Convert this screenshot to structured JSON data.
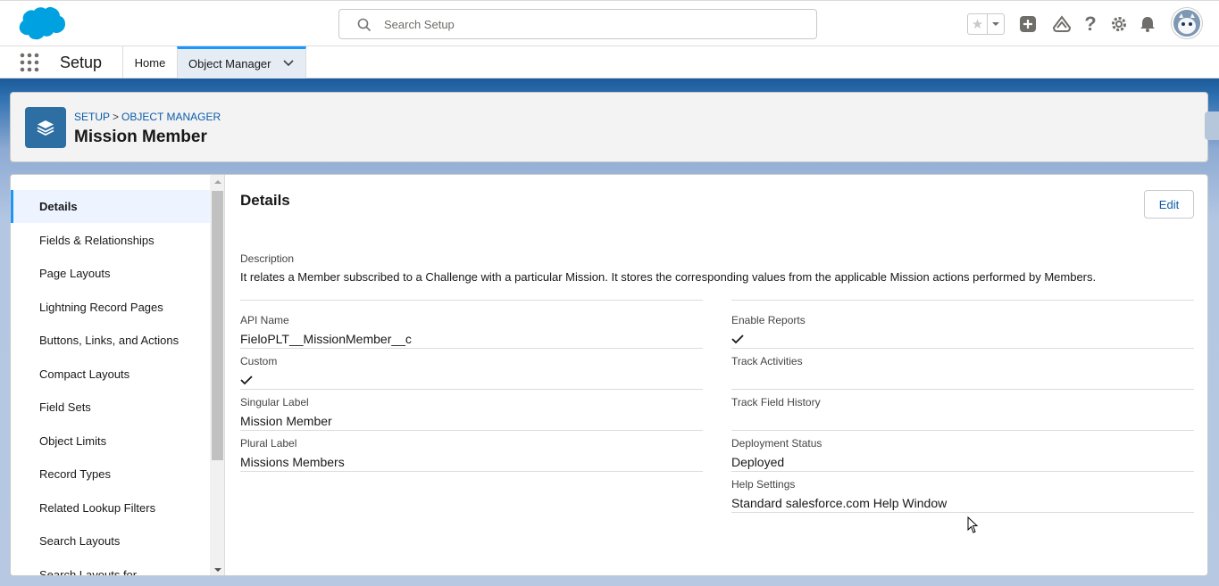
{
  "header": {
    "search_placeholder": "Search Setup",
    "icons": [
      "favorites-star-icon",
      "add-icon",
      "trailhead-icon",
      "help-icon",
      "settings-gear-icon",
      "notifications-bell-icon"
    ]
  },
  "nav": {
    "app_name": "Setup",
    "tabs": [
      {
        "label": "Home"
      },
      {
        "label": "Object Manager"
      }
    ]
  },
  "page_header": {
    "breadcrumb": [
      "SETUP",
      "OBJECT MANAGER"
    ],
    "separator": ">",
    "title": "Mission Member"
  },
  "sidebar": {
    "items": [
      {
        "label": "Details"
      },
      {
        "label": "Fields & Relationships"
      },
      {
        "label": "Page Layouts"
      },
      {
        "label": "Lightning Record Pages"
      },
      {
        "label": "Buttons, Links, and Actions"
      },
      {
        "label": "Compact Layouts"
      },
      {
        "label": "Field Sets"
      },
      {
        "label": "Object Limits"
      },
      {
        "label": "Record Types"
      },
      {
        "label": "Related Lookup Filters"
      },
      {
        "label": "Search Layouts"
      },
      {
        "label": "Search Layouts for"
      }
    ]
  },
  "details": {
    "title": "Details",
    "edit_label": "Edit",
    "description_label": "Description",
    "description_value": "It relates a Member subscribed to a Challenge with a particular Mission. It stores the corresponding values from the applicable Mission actions performed by Members.",
    "left": [
      {
        "label": "API Name",
        "value": "FieloPLT__MissionMember__c"
      },
      {
        "label": "Custom",
        "value": "",
        "checked": true
      },
      {
        "label": "Singular Label",
        "value": "Mission Member"
      },
      {
        "label": "Plural Label",
        "value": "Missions Members"
      }
    ],
    "right": [
      {
        "label": "Enable Reports",
        "value": "",
        "checked": true
      },
      {
        "label": "Track Activities",
        "value": ""
      },
      {
        "label": "Track Field History",
        "value": ""
      },
      {
        "label": "Deployment Status",
        "value": "Deployed"
      },
      {
        "label": "Help Settings",
        "value": "Standard salesforce.com Help Window"
      }
    ]
  },
  "colors": {
    "brand_blue": "#0b5cab",
    "active_tab_accent": "#1b96ff",
    "object_icon_bg": "#2e6fa3"
  }
}
